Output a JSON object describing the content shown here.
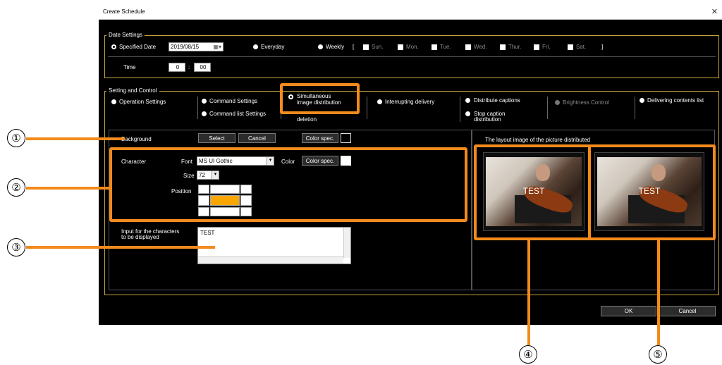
{
  "window": {
    "title": "Create Schedule",
    "close_glyph": "✕"
  },
  "date_settings": {
    "legend": "Date Settings",
    "specified_date_label": "Specified Date",
    "date_value": "2019/08/15",
    "everyday_label": "Everyday",
    "weekly_label": "Weekly",
    "bracket_open": "[",
    "bracket_close": "]",
    "days": [
      "Sun.",
      "Mon.",
      "Tue.",
      "Wed.",
      "Thur.",
      "Fri.",
      "Sat."
    ],
    "time_label": "Time",
    "time_hour": "0",
    "time_sep": ":",
    "time_min": "00"
  },
  "setting_control": {
    "legend": "Setting and Control",
    "operation_settings": "Operation Settings",
    "command_settings": "Command Settings",
    "command_list_settings": "Command list Settings",
    "simultaneous_line1": "Simultaneous",
    "simultaneous_line2": "image distribution",
    "deletion": "deletion",
    "interrupting_delivery": "Interrupting delivery",
    "distribute_captions": "Distribute captions",
    "stop_caption_line1": "Stop caption",
    "stop_caption_line2": "distribution",
    "brightness_control": "Brightness Control",
    "delivering_contents_list": "Delivering contents list"
  },
  "background": {
    "label": "Background",
    "select_button": "Select",
    "cancel_button": "Cancel",
    "color_spec_button": "Color spec."
  },
  "character": {
    "label": "Character",
    "font_label": "Font",
    "font_value": "MS UI Gothic",
    "color_label": "Color",
    "color_spec_button": "Color spec.",
    "size_label": "Size",
    "size_value": "72",
    "position_label": "Position"
  },
  "input_chars": {
    "label_line1": "Input for the characters",
    "label_line2": "to be displayed",
    "value": "TEST"
  },
  "layout_image": {
    "label": "The layout image of the picture distributed",
    "overlay_text_1": "TEST",
    "overlay_text_2": "TEST"
  },
  "footer": {
    "ok_button": "OK",
    "cancel_button": "Cancel"
  },
  "callouts": [
    "①",
    "②",
    "③",
    "④",
    "⑤"
  ],
  "colors": {
    "accent": "#f38a1c",
    "group_border": "#c8a640",
    "window_bg": "#000000"
  }
}
